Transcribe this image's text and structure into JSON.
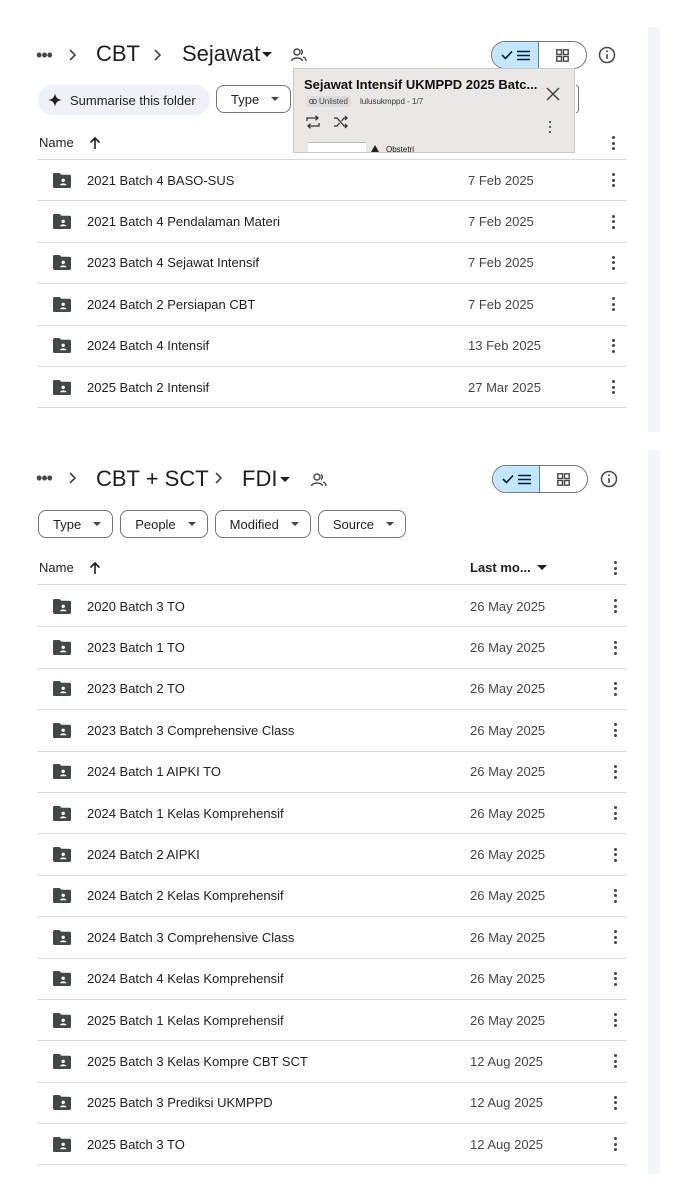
{
  "panel1": {
    "breadcrumb": [
      "CBT",
      "Sejawat"
    ],
    "summarise_label": "Summarise this folder",
    "filters": [
      {
        "label": "Type"
      }
    ],
    "col_name": "Name",
    "rows": [
      {
        "name": "2021 Batch 4 BASO-SUS",
        "date": "7 Feb 2025"
      },
      {
        "name": "2021 Batch 4 Pendalaman Materi",
        "date": "7 Feb 2025"
      },
      {
        "name": "2023 Batch 4 Sejawat Intensif",
        "date": "7 Feb 2025"
      },
      {
        "name": "2024 Batch 2 Persiapan CBT",
        "date": "7 Feb 2025"
      },
      {
        "name": "2024 Batch 4 Intensif",
        "date": "13 Feb 2025"
      },
      {
        "name": "2025 Batch 2 Intensif",
        "date": "27 Mar 2025"
      }
    ]
  },
  "overlay": {
    "title": "Sejawat Intensif UKMPPD 2025 Batc...",
    "badge": "Unlisted",
    "channel": "lulusukmppd - 1/7",
    "item": "Obstetri"
  },
  "panel2": {
    "breadcrumb": [
      "CBT + SCT",
      "FDI"
    ],
    "filters": [
      {
        "label": "Type"
      },
      {
        "label": "People"
      },
      {
        "label": "Modified"
      },
      {
        "label": "Source"
      }
    ],
    "col_name": "Name",
    "col_modified": "Last mo...",
    "rows": [
      {
        "name": "2020 Batch 3 TO",
        "date": "26 May 2025"
      },
      {
        "name": "2023 Batch 1 TO",
        "date": "26 May 2025"
      },
      {
        "name": "2023 Batch 2 TO",
        "date": "26 May 2025"
      },
      {
        "name": "2023 Batch 3 Comprehensive Class",
        "date": "26 May 2025"
      },
      {
        "name": "2024 Batch 1 AIPKI TO",
        "date": "26 May 2025"
      },
      {
        "name": "2024 Batch 1 Kelas Komprehensif",
        "date": "26 May 2025"
      },
      {
        "name": "2024 Batch 2 AIPKI",
        "date": "26 May 2025"
      },
      {
        "name": "2024 Batch 2 Kelas Komprehensif",
        "date": "26 May 2025"
      },
      {
        "name": "2024 Batch 3 Comprehensive Class",
        "date": "26 May 2025"
      },
      {
        "name": "2024 Batch 4 Kelas Komprehensif",
        "date": "26 May 2025"
      },
      {
        "name": "2025 Batch 1 Kelas Komprehensif",
        "date": "26 May 2025"
      },
      {
        "name": "2025 Batch 3 Kelas Kompre CBT SCT",
        "date": "12 Aug 2025"
      },
      {
        "name": "2025 Batch 3 Prediksi UKMPPD",
        "date": "12 Aug 2025"
      },
      {
        "name": "2025 Batch 3 TO",
        "date": "12 Aug 2025"
      }
    ]
  },
  "icons": {
    "more": "more-horiz-icon",
    "chevron": "chevron-right-icon",
    "shared": "shared-people-icon",
    "list_view": "list-view-icon",
    "grid_view": "grid-view-icon",
    "info": "info-icon",
    "sort": "arrow-up-icon",
    "folder": "shared-folder-icon",
    "kebab": "more-vert-icon"
  },
  "colors": {
    "selected_toggle": "#c2e7ff",
    "summarise_bg": "#eef1f7",
    "divider": "#dadce0",
    "text": "#1f1f1f"
  }
}
